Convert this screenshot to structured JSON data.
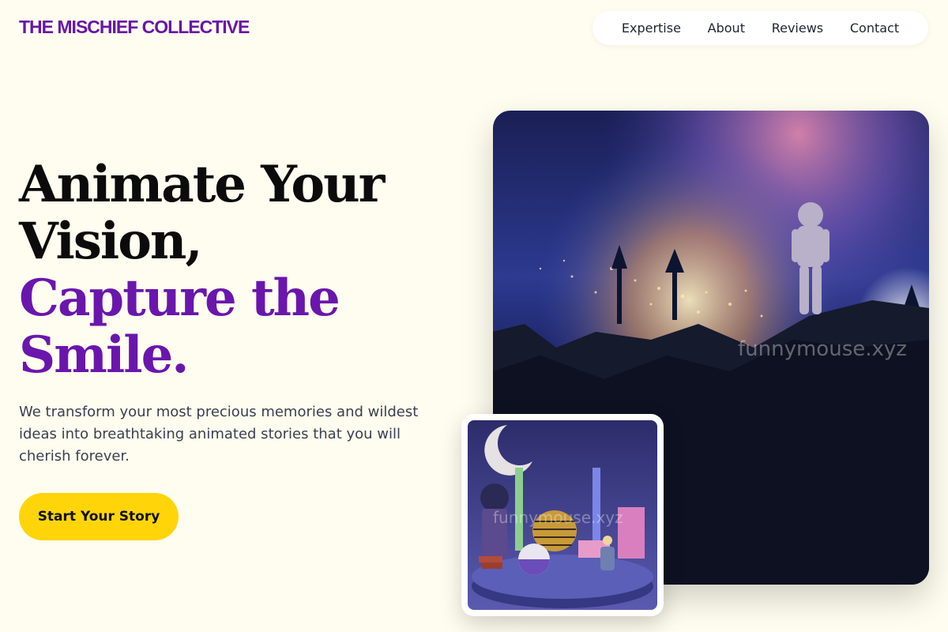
{
  "brand": {
    "name": "THE MISCHIEF COLLECTIVE"
  },
  "nav": {
    "items": [
      {
        "label": "Expertise"
      },
      {
        "label": "About"
      },
      {
        "label": "Reviews"
      },
      {
        "label": "Contact"
      }
    ]
  },
  "hero": {
    "line1": "Animate Your",
    "line2": "Vision,",
    "line3": "Capture the",
    "line4": "Smile.",
    "description": "We transform your most precious memories and wildest ideas into breathtaking animated stories that you will cherish forever.",
    "cta_label": "Start Your Story"
  },
  "images": {
    "main_watermark": "funnymouse.xyz",
    "small_watermark": "funnymouse.xyz"
  },
  "colors": {
    "brand": "#6716a8",
    "accent": "#6a16ad",
    "cta": "#ffd50a",
    "background": "#fefdef"
  }
}
